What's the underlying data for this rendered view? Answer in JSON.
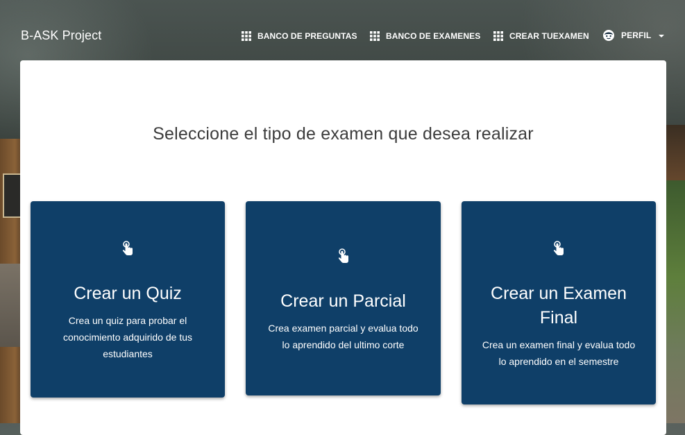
{
  "navbar": {
    "brand": "B-ASK Project",
    "items": [
      {
        "label": "BANCO DE PREGUNTAS",
        "icon": "grid-icon"
      },
      {
        "label": "BANCO DE EXAMENES",
        "icon": "grid-icon"
      },
      {
        "label": "CREAR TUEXAMEN",
        "icon": "grid-icon"
      },
      {
        "label": "PERFIL",
        "icon": "face-icon"
      }
    ]
  },
  "main": {
    "title": "Seleccione el tipo de examen que desea realizar",
    "cards": [
      {
        "icon": "tap-pointer-icon",
        "title": "Crear un Quiz",
        "description": "Crea un quiz para probar el conocimiento adquirido de tus estudiantes"
      },
      {
        "icon": "tap-pointer-icon",
        "title": "Crear un Parcial",
        "description": "Crea examen parcial y evalua todo lo aprendido del ultimo corte"
      },
      {
        "icon": "tap-pointer-icon",
        "title": "Crear un Examen Final",
        "description": "Crea un examen final y evalua todo lo aprendido en el semestre"
      }
    ]
  },
  "colors": {
    "card_background": "#0f3f68",
    "panel_background": "#ffffff",
    "nav_text": "#ffffff"
  }
}
